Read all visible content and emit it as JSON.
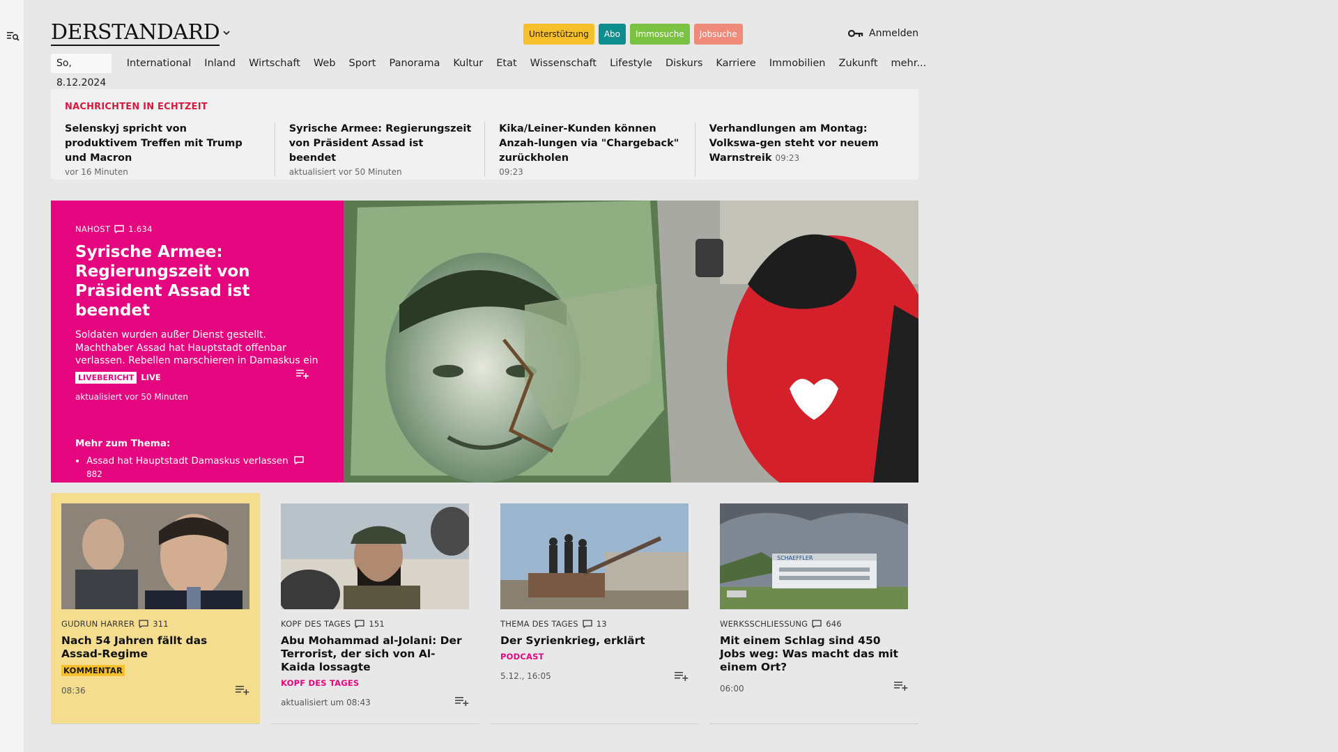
{
  "header": {
    "logo": "DERSTANDARD",
    "pills": [
      "Unterstützung",
      "Abo",
      "Immosuche",
      "Jobsuche"
    ],
    "login_label": "Anmelden"
  },
  "nav": {
    "date": "So, 8.12.2024",
    "items": [
      "International",
      "Inland",
      "Wirtschaft",
      "Web",
      "Sport",
      "Panorama",
      "Kultur",
      "Etat",
      "Wissenschaft",
      "Lifestyle",
      "Diskurs",
      "Karriere",
      "Immobilien",
      "Zukunft",
      "mehr..."
    ]
  },
  "ticker": {
    "title": "NACHRICHTEN IN ECHTZEIT",
    "items": [
      {
        "headline": "Selenskyj spricht von produktivem Treffen mit Trump und Macron",
        "time": "vor 16 Minuten"
      },
      {
        "headline": "Syrische Armee: Regierungszeit von Präsident Assad ist beendet",
        "time": "aktualisiert vor 50 Minuten"
      },
      {
        "headline": "Kika/Leiner-Kunden können Anzah-lungen via \"Chargeback\" zurückholen",
        "time": "09:23"
      },
      {
        "headline": "Verhandlungen am Montag: Volkswa-gen steht vor neuem Warnstreik",
        "time": "09:23"
      }
    ]
  },
  "hero": {
    "kicker": "NAHOST",
    "comments": "1.634",
    "title": "Syrische Armee: Regierungszeit von Präsident Assad ist beendet",
    "lead": "Soldaten wurden außer Dienst gestellt. Machthaber Assad hat Hauptstadt offenbar verlassen. Rebellen marschieren in Damaskus ein",
    "badge": "LIVEBERICHT",
    "live": "LIVE",
    "time": "aktualisiert vor 50 Minuten",
    "more_title": "Mehr zum Thema:",
    "more_item": "Assad hat Hauptstadt Damaskus verlassen",
    "more_comments": "882"
  },
  "cards": [
    {
      "kicker": "GUDRUN HARRER",
      "comments": "311",
      "title": "Nach 54 Jahren fällt das Assad-Regime",
      "label": "KOMMENTAR",
      "time": "08:36"
    },
    {
      "kicker": "KOPF DES TAGES",
      "comments": "151",
      "title": "Abu Mohammad al-Jolani: Der Terrorist, der sich von Al-Kaida lossagte",
      "label": "KOPF DES TAGES",
      "time": "aktualisiert um 08:43"
    },
    {
      "kicker": "THEMA DES TAGES",
      "comments": "13",
      "title": "Der Syrienkrieg, erklärt",
      "label": "PODCAST",
      "time": "5.12., 16:05"
    },
    {
      "kicker": "WERKSSCHLIESSUNG",
      "comments": "646",
      "title": "Mit einem Schlag sind 450 Jobs weg: Was macht das mit einem Ort?",
      "label": "",
      "time": "06:00"
    }
  ],
  "images": {
    "factory_sign": "SCHAEFFLER"
  },
  "colors": {
    "brand_pink": "#e5067f",
    "ticker_red": "#d6193d",
    "support_yellow": "#f6c02c",
    "abo_teal": "#0d8d8e",
    "immo_green": "#7bc142",
    "jobs_salmon": "#f08b7c",
    "highlight_card": "#f5dd8f"
  }
}
